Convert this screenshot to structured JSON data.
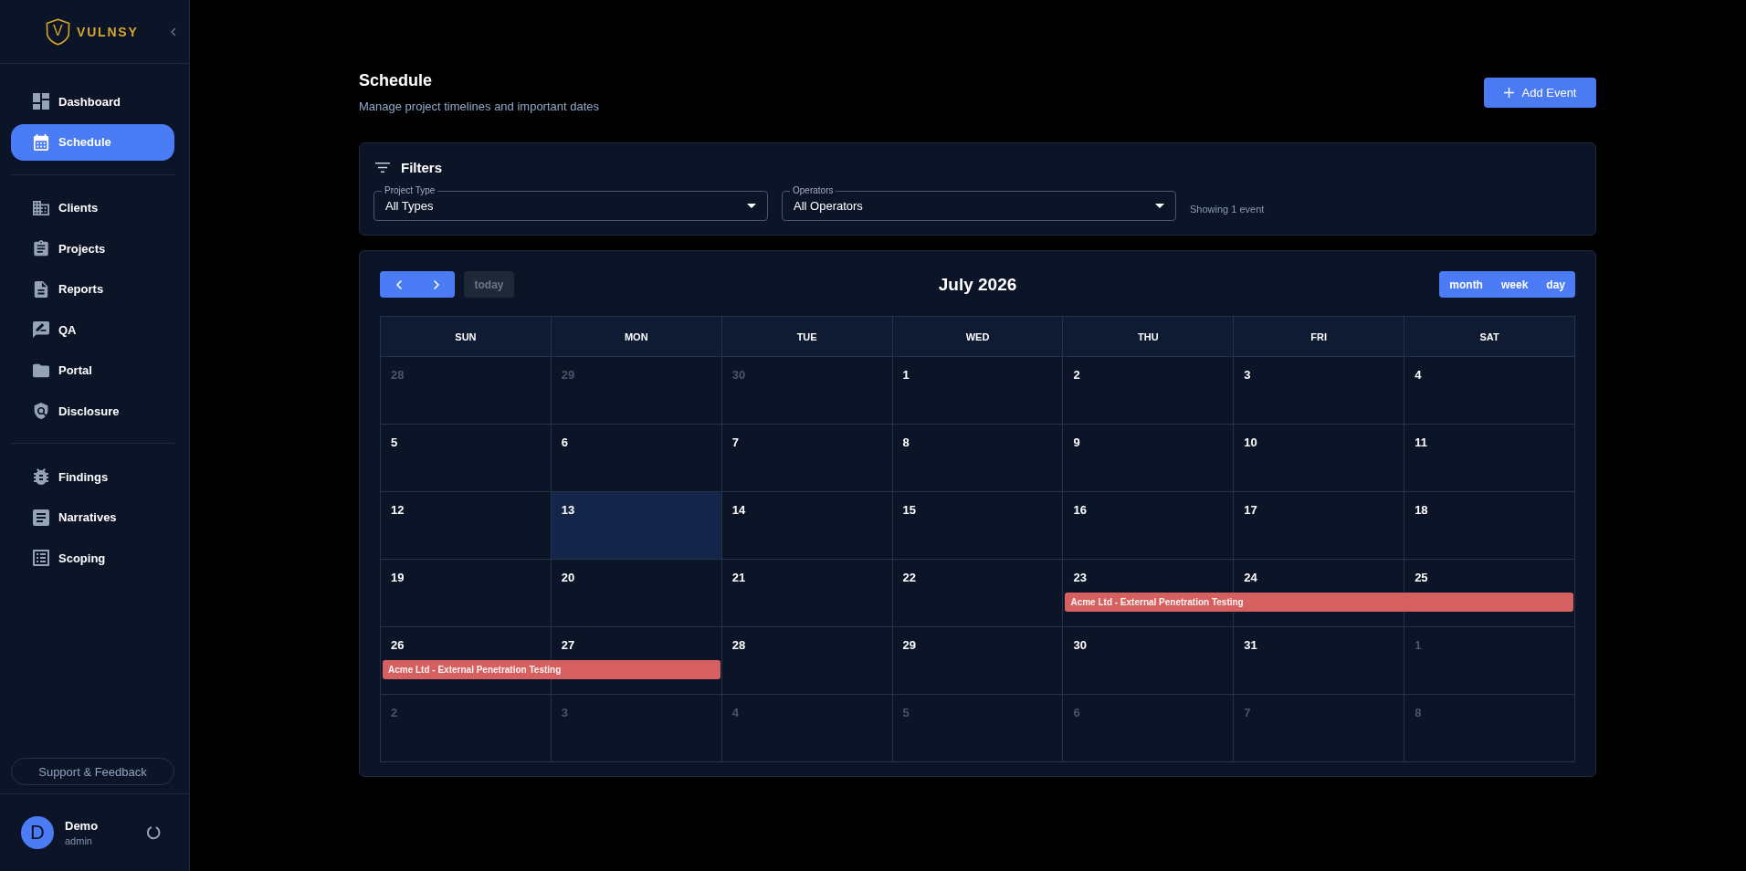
{
  "sidebar": {
    "logo": {
      "mark": "V",
      "text": "VULNSY"
    },
    "nav_groups": [
      {
        "items": [
          {
            "label": "Dashboard",
            "selected": false
          },
          {
            "label": "Schedule",
            "selected": true
          }
        ]
      },
      {
        "items": [
          {
            "label": "Clients",
            "selected": false
          },
          {
            "label": "Projects",
            "selected": false
          },
          {
            "label": "Reports",
            "selected": false
          },
          {
            "label": "QA",
            "selected": false
          },
          {
            "label": "Portal",
            "selected": false
          },
          {
            "label": "Disclosure",
            "selected": false
          }
        ]
      },
      {
        "items": [
          {
            "label": "Findings",
            "selected": false
          },
          {
            "label": "Narratives",
            "selected": false
          },
          {
            "label": "Scoping",
            "selected": false
          }
        ]
      }
    ],
    "support_button": "Support & Feedback",
    "user": {
      "initial": "D",
      "name": "Demo",
      "role": "admin"
    }
  },
  "header": {
    "title": "Schedule",
    "subtitle": "Manage project timelines and important dates",
    "add_button": "Add Event"
  },
  "filters": {
    "title": "Filters",
    "selects": [
      {
        "label": "Project Type",
        "value": "All Types"
      },
      {
        "label": "Operators",
        "value": "All Operators"
      }
    ],
    "result_count": "Showing 1 event"
  },
  "calendar": {
    "today_button": {
      "label": "today",
      "disabled": true
    },
    "title": "July 2026",
    "views": [
      "month",
      "week",
      "day"
    ],
    "weekdays": [
      "SUN",
      "MON",
      "TUE",
      "WED",
      "THU",
      "FRI",
      "SAT"
    ],
    "weeks": [
      {
        "days": [
          {
            "day": "28",
            "other_month": true,
            "today": false
          },
          {
            "day": "29",
            "other_month": true,
            "today": false
          },
          {
            "day": "30",
            "other_month": true,
            "today": false
          },
          {
            "day": "1",
            "other_month": false,
            "today": false
          },
          {
            "day": "2",
            "other_month": false,
            "today": false
          },
          {
            "day": "3",
            "other_month": false,
            "today": false
          },
          {
            "day": "4",
            "other_month": false,
            "today": false
          }
        ]
      },
      {
        "days": [
          {
            "day": "5",
            "other_month": false,
            "today": false
          },
          {
            "day": "6",
            "other_month": false,
            "today": false
          },
          {
            "day": "7",
            "other_month": false,
            "today": false
          },
          {
            "day": "8",
            "other_month": false,
            "today": false
          },
          {
            "day": "9",
            "other_month": false,
            "today": false
          },
          {
            "day": "10",
            "other_month": false,
            "today": false
          },
          {
            "day": "11",
            "other_month": false,
            "today": false
          }
        ]
      },
      {
        "days": [
          {
            "day": "12",
            "other_month": false,
            "today": false
          },
          {
            "day": "13",
            "other_month": false,
            "today": true
          },
          {
            "day": "14",
            "other_month": false,
            "today": false
          },
          {
            "day": "15",
            "other_month": false,
            "today": false
          },
          {
            "day": "16",
            "other_month": false,
            "today": false
          },
          {
            "day": "17",
            "other_month": false,
            "today": false
          },
          {
            "day": "18",
            "other_month": false,
            "today": false
          }
        ]
      },
      {
        "days": [
          {
            "day": "19",
            "other_month": false,
            "today": false
          },
          {
            "day": "20",
            "other_month": false,
            "today": false
          },
          {
            "day": "21",
            "other_month": false,
            "today": false
          },
          {
            "day": "22",
            "other_month": false,
            "today": false
          },
          {
            "day": "23",
            "other_month": false,
            "today": false
          },
          {
            "day": "24",
            "other_month": false,
            "today": false
          },
          {
            "day": "25",
            "other_month": false,
            "today": false
          }
        ],
        "events": [
          {
            "title": "Acme Ltd - External Penetration Testing",
            "color": "#d65f5f",
            "covers": [
              false,
              false,
              false,
              false,
              true,
              true,
              true
            ]
          }
        ]
      },
      {
        "days": [
          {
            "day": "26",
            "other_month": false,
            "today": false
          },
          {
            "day": "27",
            "other_month": false,
            "today": false
          },
          {
            "day": "28",
            "other_month": false,
            "today": false
          },
          {
            "day": "29",
            "other_month": false,
            "today": false
          },
          {
            "day": "30",
            "other_month": false,
            "today": false
          },
          {
            "day": "31",
            "other_month": false,
            "today": false
          },
          {
            "day": "1",
            "other_month": true,
            "today": false
          }
        ],
        "events": [
          {
            "title": "Acme Ltd - External Penetration Testing",
            "color": "#d65f5f",
            "covers": [
              true,
              true,
              false,
              false,
              false,
              false,
              false
            ]
          }
        ]
      },
      {
        "days": [
          {
            "day": "2",
            "other_month": true,
            "today": false
          },
          {
            "day": "3",
            "other_month": true,
            "today": false
          },
          {
            "day": "4",
            "other_month": true,
            "today": false
          },
          {
            "day": "5",
            "other_month": true,
            "today": false
          },
          {
            "day": "6",
            "other_month": true,
            "today": false
          },
          {
            "day": "7",
            "other_month": true,
            "today": false
          },
          {
            "day": "8",
            "other_month": true,
            "today": false
          }
        ]
      }
    ]
  }
}
